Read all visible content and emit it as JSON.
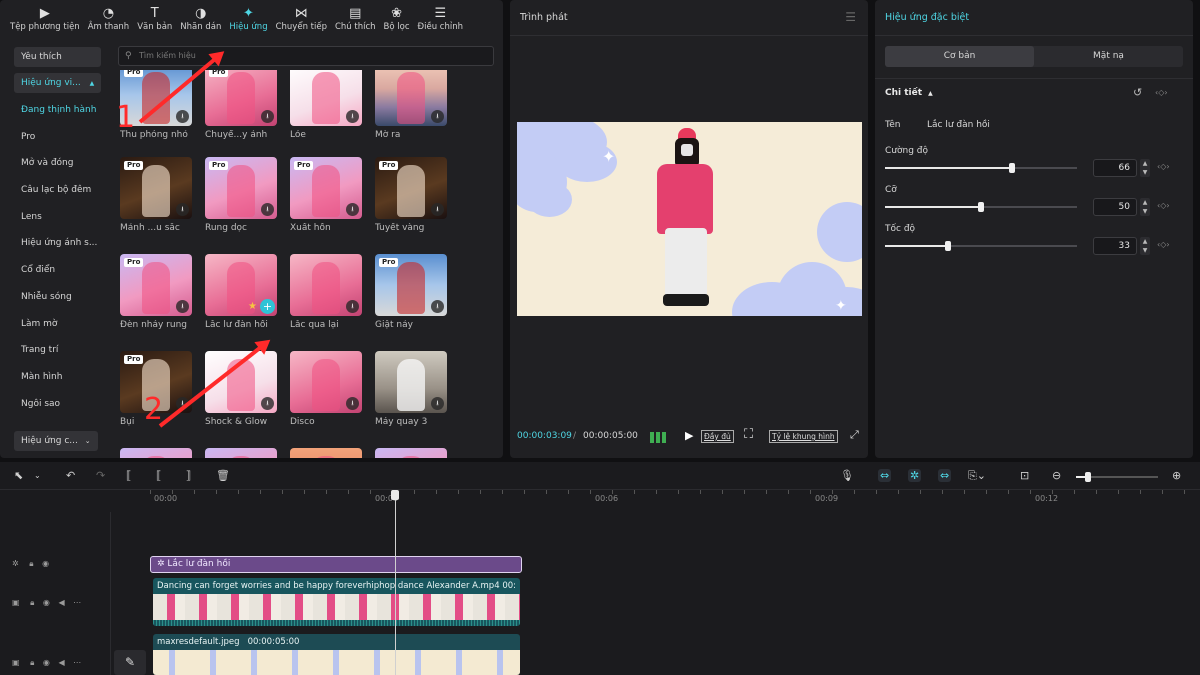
{
  "toolbar": {
    "items": [
      {
        "label": "Tệp phương tiện",
        "icon": "media-icon"
      },
      {
        "label": "Âm thanh",
        "icon": "audio-icon"
      },
      {
        "label": "Văn bản",
        "icon": "text-icon"
      },
      {
        "label": "Nhãn dán",
        "icon": "sticker-icon"
      },
      {
        "label": "Hiệu ứng",
        "icon": "effects-icon"
      },
      {
        "label": "Chuyển tiếp",
        "icon": "transition-icon"
      },
      {
        "label": "Chú thích",
        "icon": "caption-icon"
      },
      {
        "label": "Bộ lọc",
        "icon": "filter-icon"
      },
      {
        "label": "Điều chỉnh",
        "icon": "adjust-icon"
      }
    ]
  },
  "sidebar": {
    "favorites": "Yêu thích",
    "group": "Hiệu ứng vi...",
    "items": [
      "Đang thịnh hành",
      "Pro",
      "Mở và đóng",
      "Câu lạc bộ đêm",
      "Lens",
      "Hiệu ứng ánh s...",
      "Cổ điển",
      "Nhiễu sóng",
      "Làm mờ",
      "Trang trí",
      "Màn hình",
      "Ngôi sao"
    ],
    "bottom_group": "Hiệu ứng c..."
  },
  "search": {
    "placeholder": "Tìm kiếm hiệu"
  },
  "effects": [
    {
      "label": "Thu phóng nhỏ",
      "pro": true
    },
    {
      "label": "Chuyể...y ảnh",
      "pro": true
    },
    {
      "label": "Lóe",
      "pro": false
    },
    {
      "label": "Mờ ra",
      "pro": false
    },
    {
      "label": "Mảnh ...u sắc",
      "pro": true
    },
    {
      "label": "Rung dọc",
      "pro": true
    },
    {
      "label": "Xuất hồn",
      "pro": true
    },
    {
      "label": "Tuyết vàng",
      "pro": true
    },
    {
      "label": "Đèn nháy rung",
      "pro": true
    },
    {
      "label": "Lắc lư đàn hồi",
      "pro": false
    },
    {
      "label": "Lắc qua lại",
      "pro": false
    },
    {
      "label": "Giật nảy",
      "pro": true
    },
    {
      "label": "Bụi",
      "pro": true
    },
    {
      "label": "Shock & Glow",
      "pro": false
    },
    {
      "label": "Disco",
      "pro": false
    },
    {
      "label": "Máy quay 3",
      "pro": false
    }
  ],
  "player": {
    "title": "Trình phát",
    "current_time": "00:00:03:09",
    "separator": "/",
    "total_time": "00:00:05:00",
    "full_label": "Đầy đủ",
    "ratio_label": "Tỷ lệ khung hình"
  },
  "properties": {
    "title": "Hiệu ứng đặc biệt",
    "tab_basic": "Cơ bản",
    "tab_mask": "Mặt nạ",
    "section": "Chi tiết",
    "name_label": "Tên",
    "name_value": "Lắc lư đàn hồi",
    "params": [
      {
        "label": "Cường độ",
        "value": 66
      },
      {
        "label": "Cỡ",
        "value": 50
      },
      {
        "label": "Tốc độ",
        "value": 33
      }
    ]
  },
  "timeline": {
    "ruler": [
      "00:00",
      "00:03",
      "00:06",
      "00:09",
      "00:12"
    ],
    "effect_clip": "Lắc lư đàn hồi",
    "video_clip": "Dancing can forget worries and be happy foreverhiphop dance Alexander A.mp4",
    "video_clip_duration": "00:",
    "image_clip": "maxresdefault.jpeg",
    "image_clip_duration": "00:00:05:00"
  },
  "annotations": {
    "one": "1",
    "two": "2"
  },
  "colors": {
    "accent": "#4fd6e4",
    "annotation": "#ff2a2a",
    "effect_clip": "#6b4a8a",
    "video_clip": "#18565e"
  }
}
